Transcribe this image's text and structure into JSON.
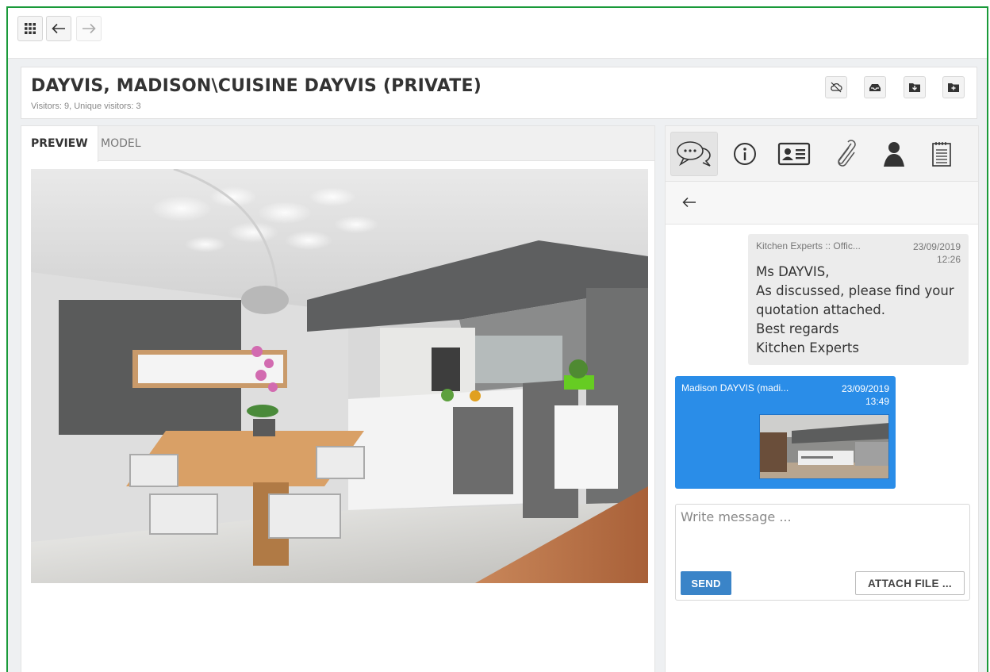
{
  "header": {
    "title": "DAYVIS, MADISON\\CUISINE DAYVIS (PRIVATE)",
    "visitors": "Visitors: 9, Unique visitors: 3"
  },
  "preview": {
    "tabs": [
      {
        "label": "PREVIEW",
        "active": true
      },
      {
        "label": "MODEL",
        "active": false
      }
    ],
    "image_subject": "kitchen-dining-room-render"
  },
  "side_panel": {
    "tab_icons": [
      "chat-icon",
      "info-icon",
      "contact-card-icon",
      "paperclip-icon",
      "user-icon",
      "notepad-icon"
    ],
    "messages": [
      {
        "sender": "Kitchen Experts :: Offic...",
        "date": "23/09/2019",
        "time": "12:26",
        "lines": [
          "Ms DAYVIS,",
          "As discussed, please find your quotation attached.",
          "Best regards",
          "Kitchen Experts"
        ]
      },
      {
        "sender": "Madison DAYVIS (madi...",
        "date": "23/09/2019",
        "time": "13:49",
        "attachment": "image-thumbnail"
      }
    ],
    "composer": {
      "placeholder": "Write message ...",
      "send_label": "SEND",
      "attach_label": "ATTACH FILE ..."
    }
  },
  "colors": {
    "frame_border": "#1a9a3a",
    "outgoing_bubble": "#2a8de8",
    "incoming_bubble": "#ececec",
    "send_button": "#3a84c8"
  }
}
